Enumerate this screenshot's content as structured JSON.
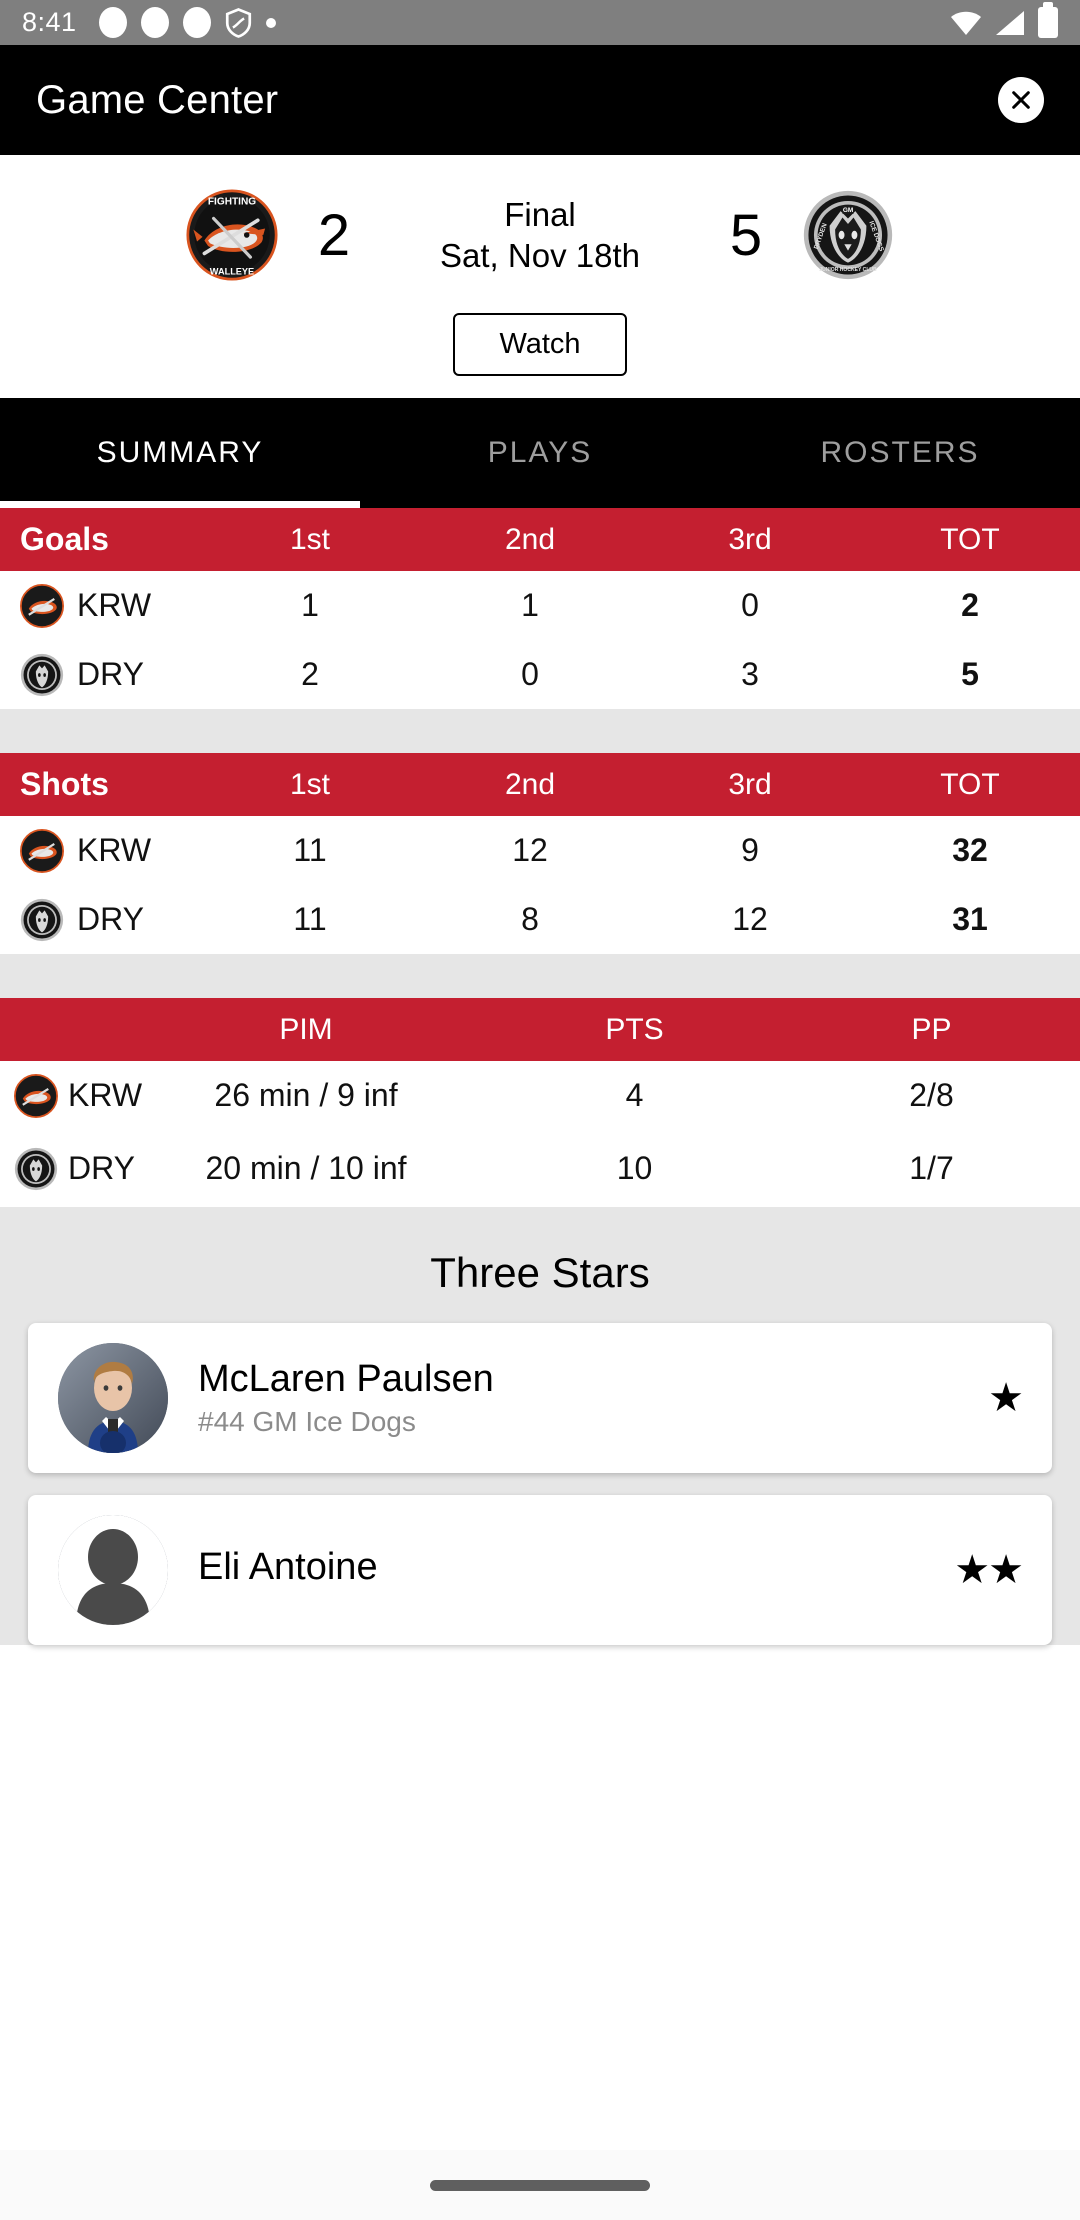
{
  "status_bar": {
    "time": "8:41",
    "icons": [
      "circle-icon",
      "circle-icon",
      "circle-icon",
      "shield-icon",
      "dot-icon"
    ],
    "right_icons": [
      "wifi-icon",
      "cellular-signal-icon",
      "battery-icon"
    ]
  },
  "app_bar": {
    "title": "Game Center",
    "close_icon": "close-icon"
  },
  "scoreboard": {
    "away": {
      "abbr": "KRW",
      "name": "Fighting Walleye",
      "score": "2",
      "logo": "fighting-walleye-logo"
    },
    "home": {
      "abbr": "DRY",
      "name": "Dryden Ice Dogs",
      "score": "5",
      "logo": "dryden-ice-dogs-logo"
    },
    "status": "Final",
    "date": "Sat, Nov 18th",
    "watch_label": "Watch"
  },
  "tabs": [
    {
      "label": "SUMMARY",
      "active": true
    },
    {
      "label": "PLAYS",
      "active": false
    },
    {
      "label": "ROSTERS",
      "active": false
    }
  ],
  "goals_table": {
    "title": "Goals",
    "columns": [
      "1st",
      "2nd",
      "3rd",
      "TOT"
    ],
    "rows": [
      {
        "team": "KRW",
        "values": [
          "1",
          "1",
          "0"
        ],
        "total": "2"
      },
      {
        "team": "DRY",
        "values": [
          "2",
          "0",
          "3"
        ],
        "total": "5"
      }
    ]
  },
  "shots_table": {
    "title": "Shots",
    "columns": [
      "1st",
      "2nd",
      "3rd",
      "TOT"
    ],
    "rows": [
      {
        "team": "KRW",
        "values": [
          "11",
          "12",
          "9"
        ],
        "total": "32"
      },
      {
        "team": "DRY",
        "values": [
          "11",
          "8",
          "12"
        ],
        "total": "31"
      }
    ]
  },
  "penalties_table": {
    "title": "",
    "columns": [
      "PIM",
      "PTS",
      "PP"
    ],
    "rows": [
      {
        "team": "KRW",
        "pim": "26 min / 9 inf",
        "pts": "4",
        "pp": "2/8"
      },
      {
        "team": "DRY",
        "pim": "20 min / 10 inf",
        "pts": "10",
        "pp": "1/7"
      }
    ]
  },
  "three_stars": {
    "title": "Three Stars",
    "players": [
      {
        "name": "McLaren Paulsen",
        "detail": "#44 GM Ice Dogs",
        "stars": "★"
      },
      {
        "name": "Eli Antoine",
        "detail": "",
        "stars": "★★"
      }
    ]
  },
  "colors": {
    "accent_red": "#c41f30",
    "header_black": "#000000",
    "section_gray": "#e6e6e6"
  }
}
